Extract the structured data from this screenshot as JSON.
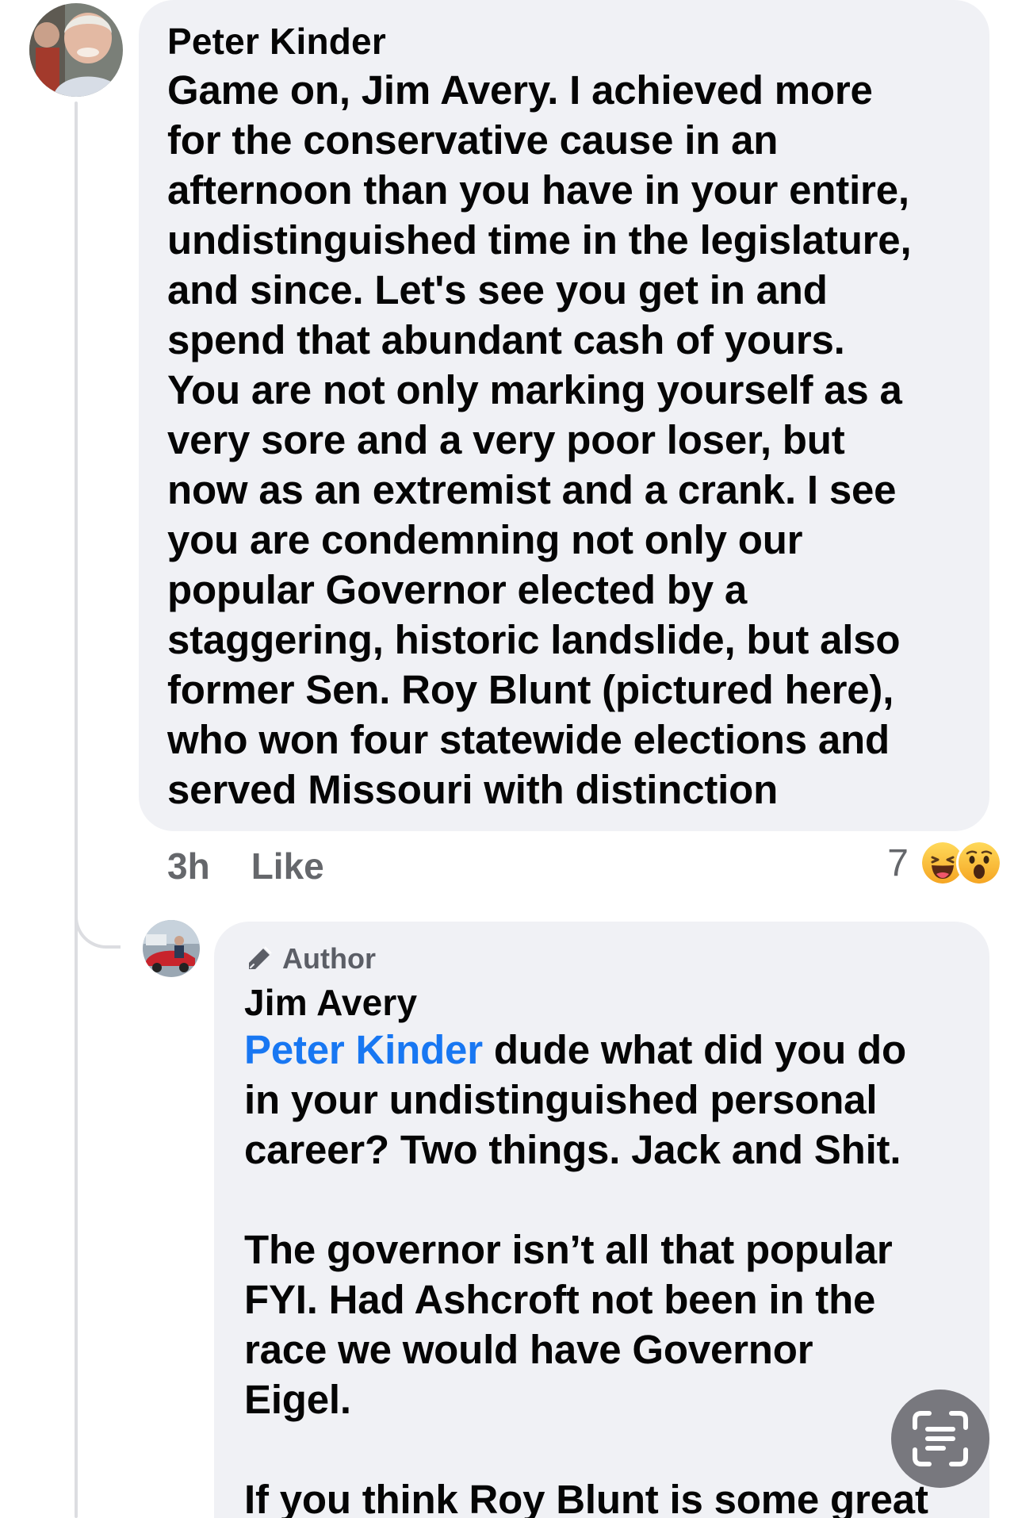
{
  "thread": {
    "parent_comment": {
      "author": "Peter Kinder",
      "text": "Game on, Jim Avery. I achieved more\nfor the conservative cause in an\nafternoon than you have in your entire,\nundistinguished time in the legislature,\nand since. Let's see you get in and\nspend that abundant cash of yours.\nYou are not only marking yourself as a\nvery sore and a very poor loser, but\nnow as an extremist and a crank. I see\nyou are condemning not only our\npopular Governor elected by a\nstaggering, historic landslide, but also\nformer Sen. Roy Blunt (pictured here),\nwho won four statewide elections and\nserved Missouri with distinction",
      "timestamp": "3h",
      "like_label": "Like",
      "reaction_count": "7",
      "reactions": [
        "haha-icon",
        "wow-icon"
      ]
    },
    "reply": {
      "badge_label": "Author",
      "author": "Jim Avery",
      "mention": "Peter Kinder",
      "text_after_mention": " dude what did you do\nin your undistinguished personal\ncareer? Two things. Jack and Shit.\n\nThe governor isn’t all that popular\nFYI. Had Ashcroft not been in the\nrace we would have Governor\nEigel.\n\nIf you think Roy Blunt is some great"
    }
  },
  "colors": {
    "bubble_bg": "#f0f1f5",
    "text": "#050505",
    "secondary_text": "#65676b",
    "mention": "#1877f2"
  },
  "floating_button": {
    "icon": "live-text-scan-icon"
  }
}
